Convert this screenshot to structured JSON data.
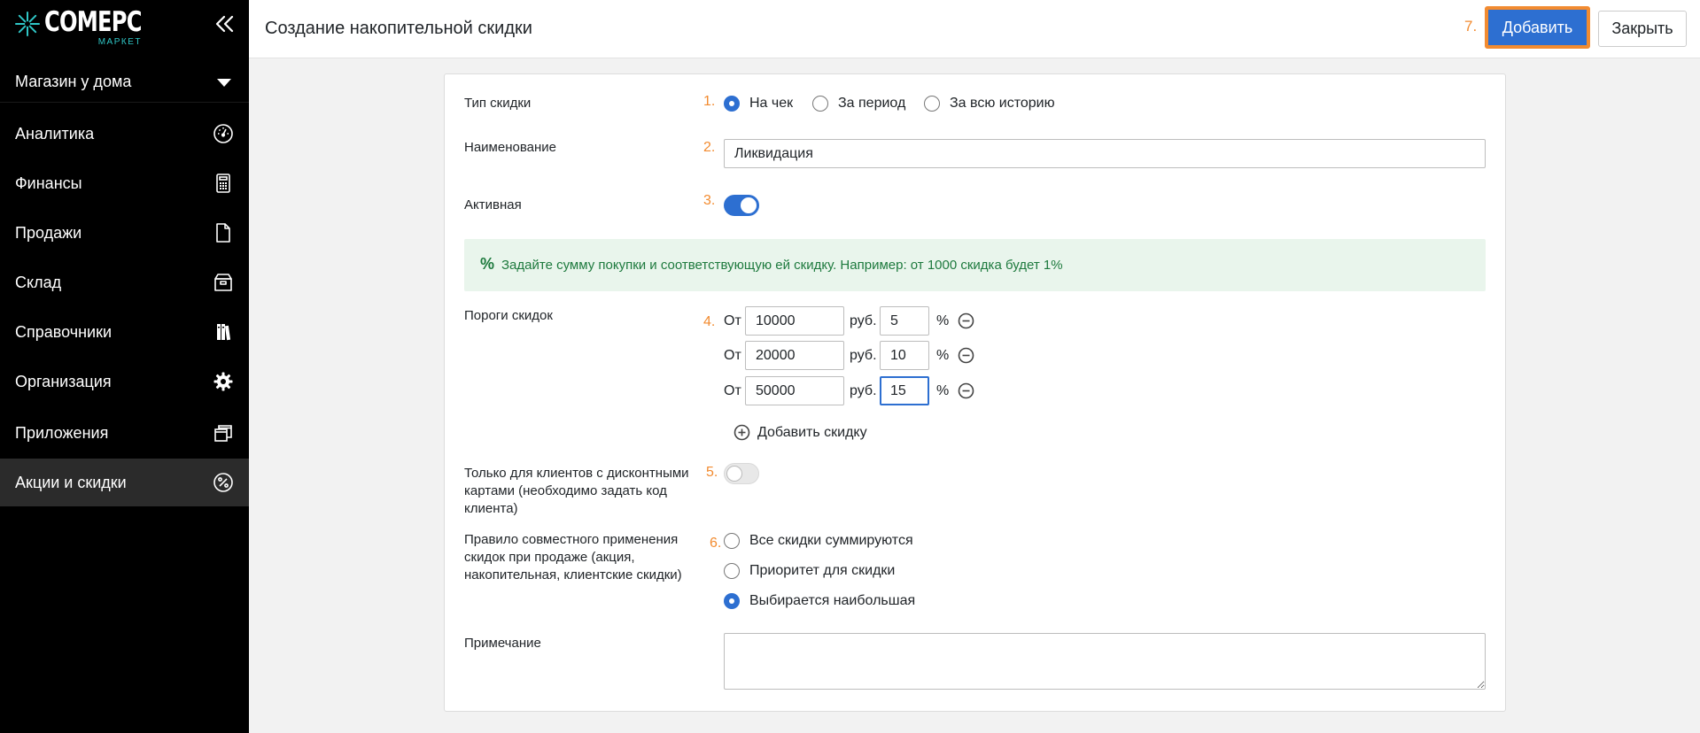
{
  "logo": {
    "main": "COMEPC",
    "sub": "МАРКЕТ"
  },
  "sidebar": {
    "store": "Магазин у дома",
    "items": [
      {
        "label": "Аналитика",
        "icon": "gauge-icon"
      },
      {
        "label": "Финансы",
        "icon": "calculator-icon"
      },
      {
        "label": "Продажи",
        "icon": "document-icon"
      },
      {
        "label": "Склад",
        "icon": "box-icon"
      },
      {
        "label": "Справочники",
        "icon": "books-icon"
      },
      {
        "label": "Организация",
        "icon": "gear-icon"
      },
      {
        "label": "Приложения",
        "icon": "windows-icon"
      },
      {
        "label": "Акции и скидки",
        "icon": "percent-badge-icon",
        "active": true
      }
    ]
  },
  "header": {
    "title": "Создание накопительной скидки",
    "step": "7.",
    "add_label": "Добавить",
    "close_label": "Закрыть"
  },
  "form": {
    "discount_type": {
      "label": "Тип скидки",
      "step": "1.",
      "options": [
        "На чек",
        "За период",
        "За всю историю"
      ],
      "selected": "На чек"
    },
    "name": {
      "label": "Наименование",
      "step": "2.",
      "value": "Ликвидация"
    },
    "active": {
      "label": "Активная",
      "step": "3.",
      "on": true
    },
    "info": {
      "icon": "%",
      "text": "Задайте сумму покупки и соответствующую ей скидку. Например: от 1000 скидка будет 1%"
    },
    "thresholds": {
      "label": "Пороги скидок",
      "step": "4.",
      "from_label": "От",
      "currency": "руб.",
      "percent": "%",
      "rows": [
        {
          "amount": "10000",
          "discount": "5"
        },
        {
          "amount": "20000",
          "discount": "10"
        },
        {
          "amount": "50000",
          "discount": "15"
        }
      ],
      "add_label": "Добавить скидку"
    },
    "card_only": {
      "label_lines": [
        "Только для клиентов с дисконтными",
        "картами (необходимо задать код",
        "клиента)"
      ],
      "step": "5.",
      "on": false
    },
    "combine_rule": {
      "label_lines": [
        "Правило совместного применения",
        "скидок при продаже (акция,",
        "накопительная, клиентские скидки)"
      ],
      "step": "6.",
      "options": [
        "Все скидки суммируются",
        "Приоритет для скидки",
        "Выбирается наибольшая"
      ],
      "selected": "Выбирается наибольшая"
    },
    "note": {
      "label": "Примечание",
      "value": ""
    }
  },
  "colors": {
    "accent": "#2d6fd1",
    "highlight": "#f28b30",
    "info_bg": "#e9f5ec",
    "info_text": "#1e7a3e",
    "sidebar_bg": "#000000"
  }
}
